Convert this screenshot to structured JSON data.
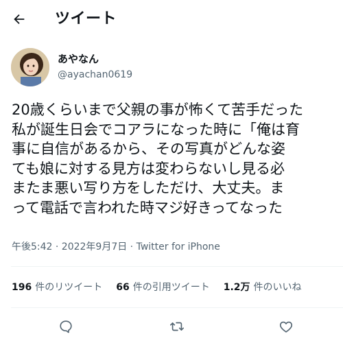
{
  "header": {
    "title": "ツイート",
    "back_icon": "arrow-left-icon"
  },
  "author": {
    "name": "あやなん",
    "handle": "@ayachan0619",
    "avatar_icon": "profile-photo"
  },
  "tweet": {
    "lines": [
      "20歳くらいまで父親の事が怖くて苦手だった",
      "私が誕生日会でコアラになった時に「俺は育",
      "事に自信があるから、その写真がどんな姿",
      "ても娘に対する見方は変わらないし見る必",
      "またま悪い写り方をしただけ、大丈夫。ま",
      "って電話で言われた時マジ好きってなった"
    ]
  },
  "meta": {
    "text": "午後5:42 · 2022年9月7日 · Twitter for iPhone"
  },
  "stats": {
    "retweets": {
      "count": "196",
      "label": "件のリツイート"
    },
    "quotes": {
      "count": "66",
      "label": "件の引用ツイート"
    },
    "likes": {
      "count": "1.2万",
      "label": "件のいいね"
    }
  },
  "actions": {
    "reply_icon": "reply-icon",
    "retweet_icon": "retweet-icon",
    "like_icon": "heart-icon"
  },
  "colors": {
    "text": "#0f1419",
    "secondary": "#536471",
    "divider": "#eff3f4"
  }
}
